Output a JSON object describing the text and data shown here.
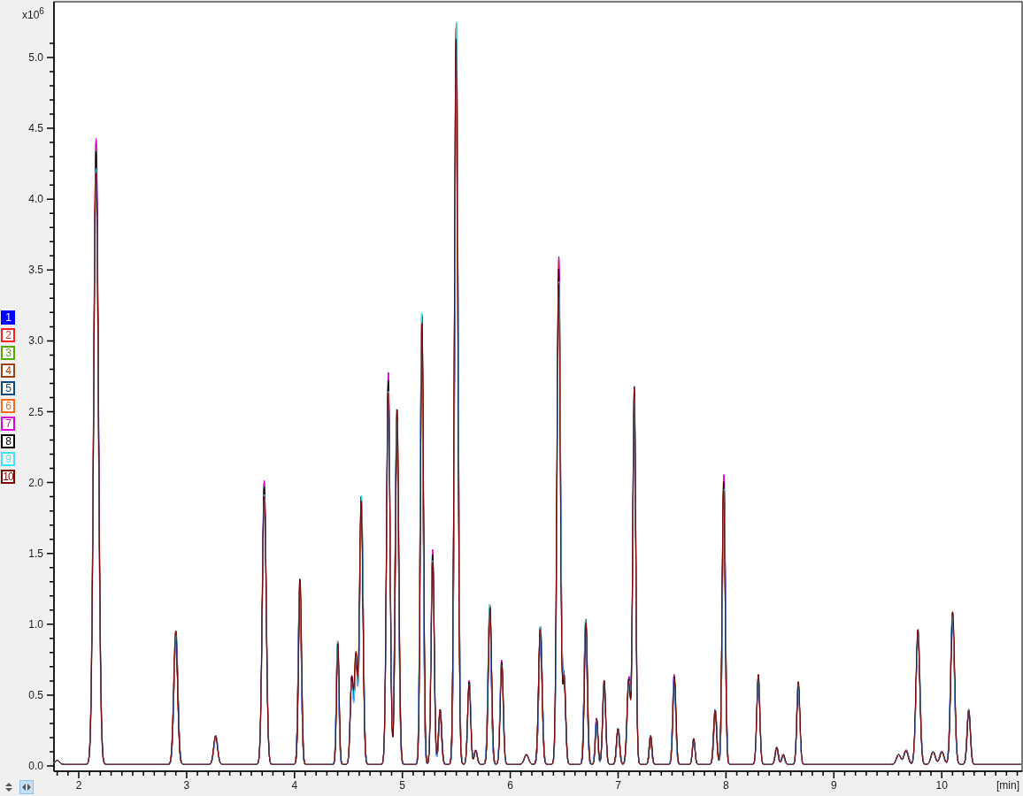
{
  "y_axis": {
    "multiplier": "x10$^{6}$",
    "tick_labels": [
      "5.0",
      "4.5",
      "4.0",
      "3.5",
      "3.0",
      "2.5",
      "2.0",
      "1.5",
      "1.0",
      "0.5",
      "0.0"
    ]
  },
  "x_axis": {
    "tick_labels": [
      "2",
      "3",
      "4",
      "5",
      "6",
      "7",
      "8",
      "9",
      "10"
    ],
    "unit": "[min]"
  },
  "traces": [
    {
      "label": "1",
      "color": "#0000ff",
      "selected": true
    },
    {
      "label": "2",
      "color": "#ff2020",
      "selected": false
    },
    {
      "label": "3",
      "color": "#55aa00",
      "selected": false
    },
    {
      "label": "4",
      "color": "#a0400a",
      "selected": false
    },
    {
      "label": "5",
      "color": "#0a4a80",
      "selected": false
    },
    {
      "label": "6",
      "color": "#ff6a10",
      "selected": false
    },
    {
      "label": "7",
      "color": "#e000e0",
      "selected": false
    },
    {
      "label": "8",
      "color": "#000000",
      "selected": false
    },
    {
      "label": "9",
      "color": "#40e0ff",
      "selected": false
    },
    {
      "label": "10",
      "color": "#800000",
      "selected": false
    }
  ],
  "toolbar": [
    {
      "kind": "vertical",
      "selected": false
    },
    {
      "kind": "horizontal",
      "selected": true
    }
  ]
}
